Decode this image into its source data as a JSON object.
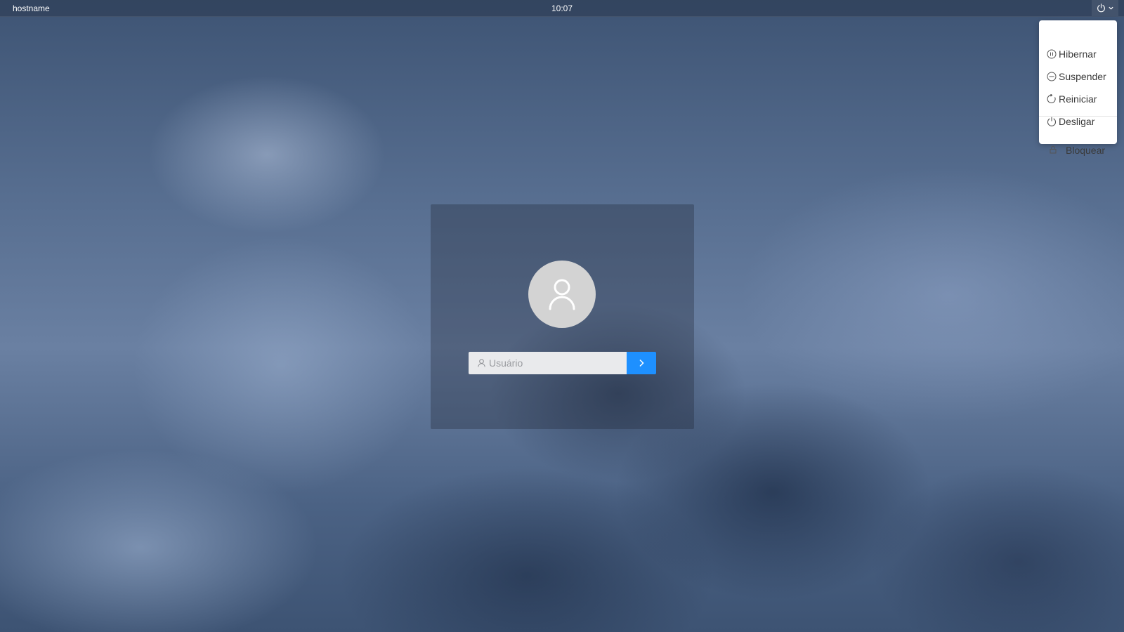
{
  "top_bar": {
    "hostname": "hostname",
    "clock": "10:07",
    "power_menu_icon": "power-icon"
  },
  "power_menu": {
    "items": [
      {
        "label": "Hibernar",
        "icon": "hibernate-icon"
      },
      {
        "label": "Suspender",
        "icon": "suspend-icon"
      },
      {
        "label": "Reiniciar",
        "icon": "restart-icon"
      },
      {
        "label": "Desligar",
        "icon": "power-off-icon"
      },
      {
        "label": "Bloquear",
        "icon": "lock-icon"
      }
    ]
  },
  "login": {
    "avatar_icon": "user-avatar-icon",
    "username_placeholder": "Usuário",
    "username_value": "",
    "submit_icon": "chevron-right-icon"
  },
  "colors": {
    "accent": "#1e90ff",
    "menu_background": "#ffffff",
    "menu_text": "#3a3a3a",
    "avatar_background": "#d3d3d3"
  }
}
